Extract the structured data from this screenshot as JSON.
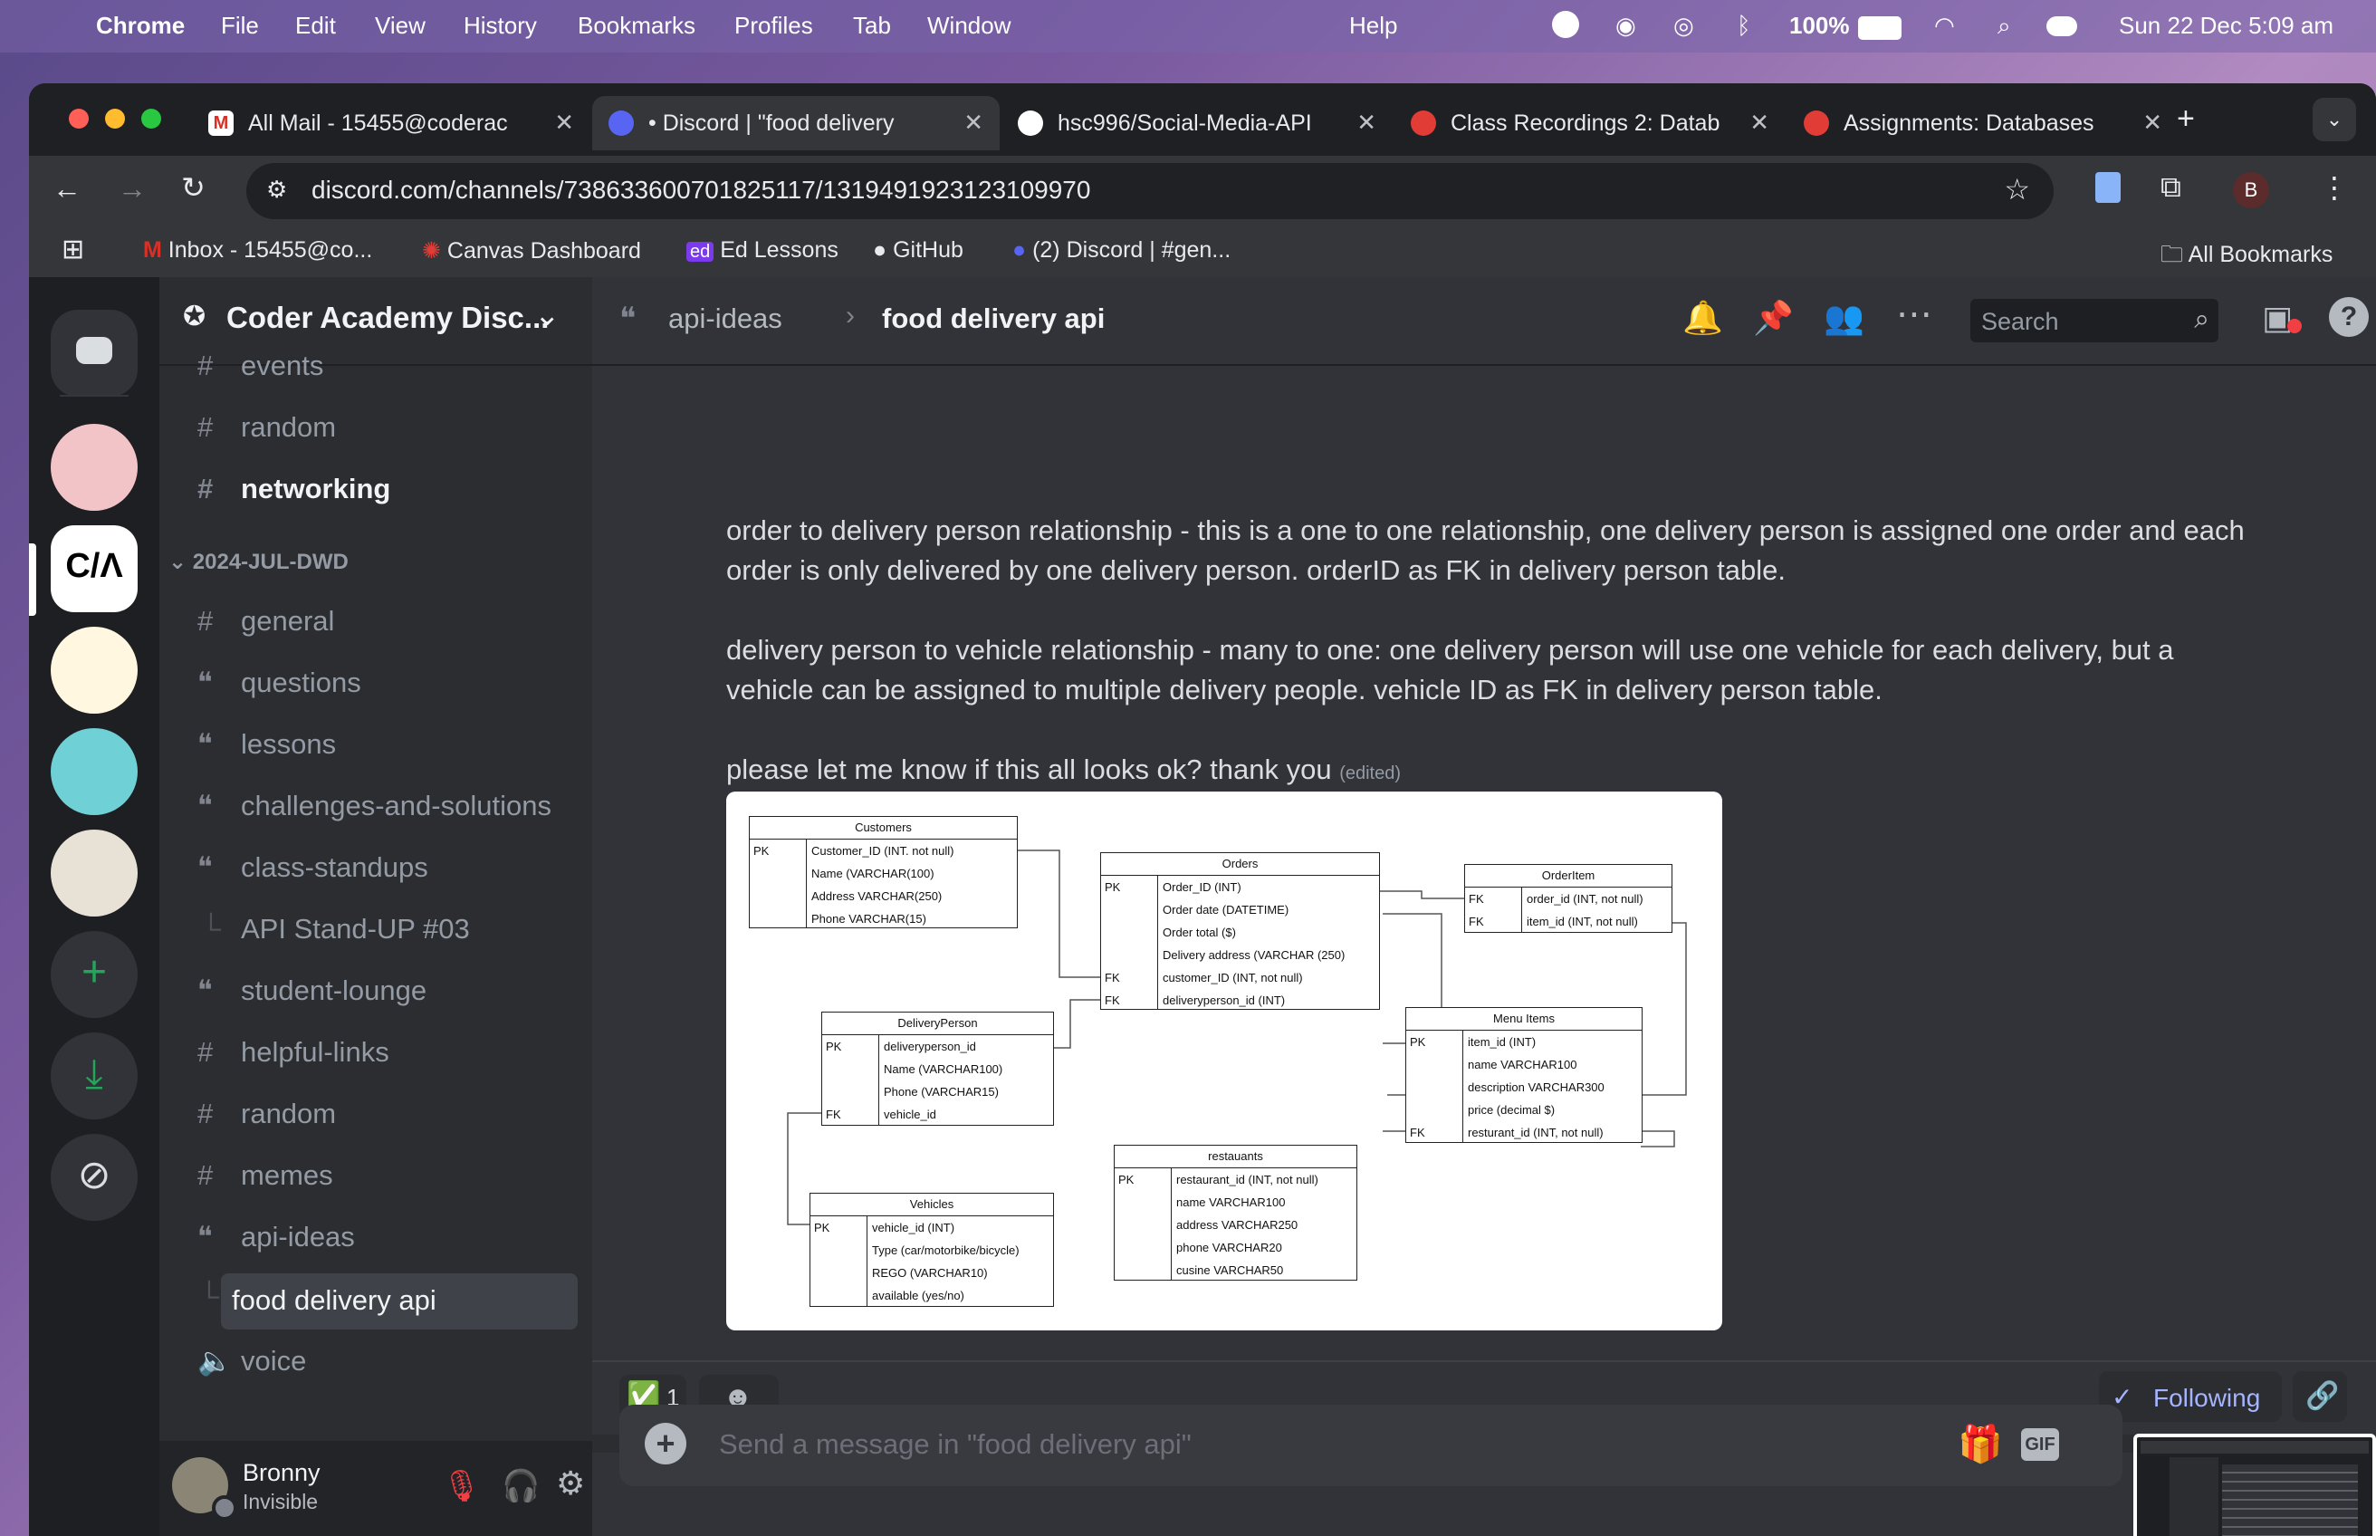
{
  "menubar": {
    "app": "Chrome",
    "items": [
      "File",
      "Edit",
      "View",
      "History",
      "Bookmarks",
      "Profiles",
      "Tab",
      "Window"
    ],
    "help": "Help",
    "battery": "100%",
    "datetime": "Sun 22 Dec  5:09 am"
  },
  "tabs": [
    {
      "title": "All Mail - 15455@coderac",
      "favicon": "gmail-icon",
      "active": false
    },
    {
      "title": "• Discord | \"food delivery",
      "favicon": "discord-icon",
      "active": true
    },
    {
      "title": "hsc996/Social-Media-API",
      "favicon": "github-icon",
      "active": false
    },
    {
      "title": "Class Recordings 2: Datab",
      "favicon": "canvas-icon",
      "active": false
    },
    {
      "title": "Assignments: Databases",
      "favicon": "canvas-icon",
      "active": false
    }
  ],
  "url": "discord.com/channels/738633600701825117/1319491923123109970",
  "profile_initial": "B",
  "bookmarks": [
    {
      "label": "Inbox - 15455@co...",
      "icon": "gmail-icon"
    },
    {
      "label": "Canvas Dashboard",
      "icon": "canvas-icon"
    },
    {
      "label": "Ed Lessons",
      "icon": "ed-icon"
    },
    {
      "label": "GitHub",
      "icon": "github-icon"
    },
    {
      "label": "(2) Discord | #gen...",
      "icon": "discord-icon"
    }
  ],
  "all_bookmarks": "All Bookmarks",
  "server": {
    "name": "Coder Academy Disc..."
  },
  "channels_top": [
    {
      "label": "events",
      "type": "text"
    },
    {
      "label": "random",
      "type": "text"
    },
    {
      "label": "networking",
      "type": "text",
      "bold": true
    }
  ],
  "category": "2024-JUL-DWD",
  "channels": [
    {
      "label": "general",
      "type": "text"
    },
    {
      "label": "questions",
      "type": "forum"
    },
    {
      "label": "lessons",
      "type": "forum"
    },
    {
      "label": "challenges-and-solutions",
      "type": "forum"
    },
    {
      "label": "class-standups",
      "type": "forum"
    },
    {
      "label": "API Stand-UP #03",
      "type": "thread"
    },
    {
      "label": "student-lounge",
      "type": "forum"
    },
    {
      "label": "helpful-links",
      "type": "text"
    },
    {
      "label": "random",
      "type": "text"
    },
    {
      "label": "memes",
      "type": "text"
    },
    {
      "label": "api-ideas",
      "type": "forum"
    },
    {
      "label": "food delivery api",
      "type": "thread-active"
    },
    {
      "label": "voice",
      "type": "voice"
    }
  ],
  "user": {
    "name": "Bronny",
    "status": "Invisible"
  },
  "header": {
    "parent": "api-ideas",
    "thread": "food delivery api",
    "search_placeholder": "Search"
  },
  "messages": {
    "p1": "order to delivery person relationship - this is a one to one relationship, one delivery person is assigned one order and each order is only delivered by one delivery person. orderID as FK in delivery person table.",
    "p2": "delivery person to vehicle relationship - many to one: one delivery person will use one vehicle for each delivery, but a vehicle can be assigned to multiple delivery people. vehicle ID as FK in delivery person table.",
    "p3": "please let me know if this all looks ok? thank you",
    "edited": "(edited)"
  },
  "erd": {
    "customers": {
      "title": "Customers",
      "rows": [
        [
          "PK",
          "Customer_ID (INT. not null)"
        ],
        [
          "",
          "Name (VARCHAR(100)"
        ],
        [
          "",
          "Address VARCHAR(250)"
        ],
        [
          "",
          "Phone VARCHAR(15)"
        ]
      ]
    },
    "orders": {
      "title": "Orders",
      "rows": [
        [
          "PK",
          "Order_ID (INT)"
        ],
        [
          "",
          "Order date (DATETIME)"
        ],
        [
          "",
          "Order total ($)"
        ],
        [
          "",
          "Delivery address (VARCHAR (250)"
        ],
        [
          "FK",
          "customer_ID (INT, not null)"
        ],
        [
          "FK",
          "deliveryperson_id (INT)"
        ]
      ]
    },
    "orderitem": {
      "title": "OrderItem",
      "rows": [
        [
          "FK",
          "order_id (INT, not null)"
        ],
        [
          "FK",
          "item_id (INT, not null)"
        ]
      ]
    },
    "delivery": {
      "title": "DeliveryPerson",
      "rows": [
        [
          "PK",
          "deliveryperson_id"
        ],
        [
          "",
          "Name (VARCHAR100)"
        ],
        [
          "",
          "Phone (VARCHAR15)"
        ],
        [
          "FK",
          "vehicle_id"
        ]
      ]
    },
    "menu": {
      "title": "Menu Items",
      "rows": [
        [
          "PK",
          "item_id (INT)"
        ],
        [
          "",
          "name VARCHAR100"
        ],
        [
          "",
          "description VARCHAR300"
        ],
        [
          "",
          "price (decimal $)"
        ],
        [
          "FK",
          "resturant_id (INT, not null)"
        ]
      ]
    },
    "restaurants": {
      "title": "restauants",
      "rows": [
        [
          "PK",
          "restaurant_id (INT, not null)"
        ],
        [
          "",
          "name VARCHAR100"
        ],
        [
          "",
          "address VARCHAR250"
        ],
        [
          "",
          "phone VARCHAR20"
        ],
        [
          "",
          "cusine VARCHAR50"
        ]
      ]
    },
    "vehicles": {
      "title": "Vehicles",
      "rows": [
        [
          "PK",
          "vehicle_id (INT)"
        ],
        [
          "",
          "Type (car/motorbike/bicycle)"
        ],
        [
          "",
          "REGO (VARCHAR10)"
        ],
        [
          "",
          "available (yes/no)"
        ]
      ]
    }
  },
  "reaction": {
    "emoji": "✅",
    "count": "1"
  },
  "following": "Following",
  "composer_placeholder": "Send a message in \"food delivery api\"",
  "gif": "GIF",
  "colors": {
    "accent": "#5865f2",
    "green": "#23a55a",
    "following": "#a4b4ff"
  }
}
